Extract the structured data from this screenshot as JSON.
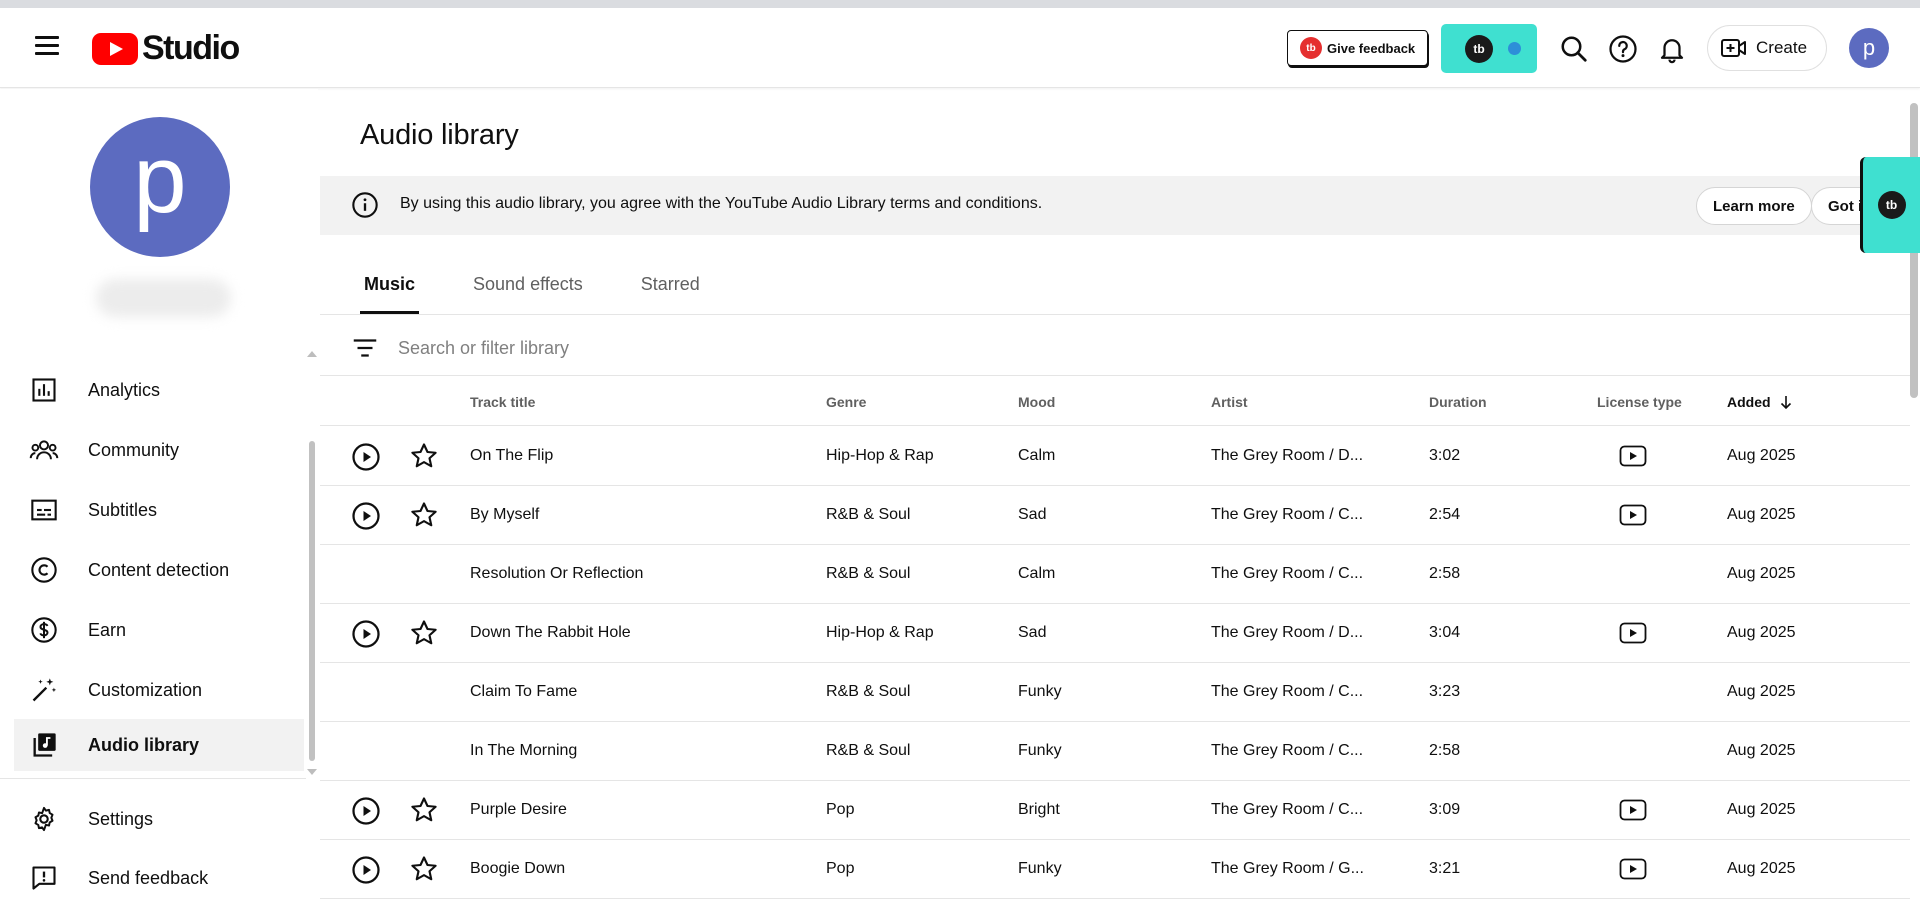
{
  "header": {
    "logo_text": "Studio",
    "feedback_label": "Give feedback",
    "feedback_badge": "tb",
    "ext_badge": "tb",
    "create_label": "Create",
    "avatar_letter": "p"
  },
  "sidebar": {
    "avatar_letter": "p",
    "items": [
      {
        "label": "Analytics",
        "icon": "analytics-icon"
      },
      {
        "label": "Community",
        "icon": "community-icon"
      },
      {
        "label": "Subtitles",
        "icon": "subtitles-icon"
      },
      {
        "label": "Content detection",
        "icon": "copyright-icon"
      },
      {
        "label": "Earn",
        "icon": "dollar-icon"
      },
      {
        "label": "Customization",
        "icon": "magic-wand-icon"
      },
      {
        "label": "Audio library",
        "icon": "audio-library-icon"
      },
      {
        "label": "Settings",
        "icon": "gear-icon"
      },
      {
        "label": "Send feedback",
        "icon": "feedback-icon"
      }
    ],
    "active_item": "Audio library"
  },
  "main": {
    "title": "Audio library",
    "banner": {
      "message": "By using this audio library, you agree with the YouTube Audio Library terms and conditions.",
      "learn_more": "Learn more",
      "got_it": "Got it"
    },
    "tabs": [
      {
        "label": "Music",
        "active": true
      },
      {
        "label": "Sound effects",
        "active": false
      },
      {
        "label": "Starred",
        "active": false
      }
    ],
    "search_placeholder": "Search or filter library",
    "columns": {
      "track_title": "Track title",
      "genre": "Genre",
      "mood": "Mood",
      "artist": "Artist",
      "duration": "Duration",
      "license_type": "License type",
      "added": "Added"
    },
    "rows": [
      {
        "title": "On The Flip",
        "genre": "Hip-Hop & Rap",
        "mood": "Calm",
        "artist": "The Grey Room / D...",
        "duration": "3:02",
        "added": "Aug 2025",
        "actions": true,
        "license": true
      },
      {
        "title": "By Myself",
        "genre": "R&B & Soul",
        "mood": "Sad",
        "artist": "The Grey Room / C...",
        "duration": "2:54",
        "added": "Aug 2025",
        "actions": true,
        "license": true
      },
      {
        "title": "Resolution Or Reflection",
        "genre": "R&B & Soul",
        "mood": "Calm",
        "artist": "The Grey Room / C...",
        "duration": "2:58",
        "added": "Aug 2025",
        "actions": false,
        "license": false
      },
      {
        "title": "Down The Rabbit Hole",
        "genre": "Hip-Hop & Rap",
        "mood": "Sad",
        "artist": "The Grey Room / D...",
        "duration": "3:04",
        "added": "Aug 2025",
        "actions": true,
        "license": true
      },
      {
        "title": "Claim To Fame",
        "genre": "R&B & Soul",
        "mood": "Funky",
        "artist": "The Grey Room / C...",
        "duration": "3:23",
        "added": "Aug 2025",
        "actions": false,
        "license": false
      },
      {
        "title": "In The Morning",
        "genre": "R&B & Soul",
        "mood": "Funky",
        "artist": "The Grey Room / C...",
        "duration": "2:58",
        "added": "Aug 2025",
        "actions": false,
        "license": false
      },
      {
        "title": "Purple Desire",
        "genre": "Pop",
        "mood": "Bright",
        "artist": "The Grey Room / C...",
        "duration": "3:09",
        "added": "Aug 2025",
        "actions": true,
        "license": true
      },
      {
        "title": "Boogie Down",
        "genre": "Pop",
        "mood": "Funky",
        "artist": "The Grey Room / G...",
        "duration": "3:21",
        "added": "Aug 2025",
        "actions": true,
        "license": true
      }
    ]
  },
  "colors": {
    "brand_red": "#ff0000",
    "avatar": "#5c6bc0",
    "extension_teal": "#3fe0d0"
  }
}
